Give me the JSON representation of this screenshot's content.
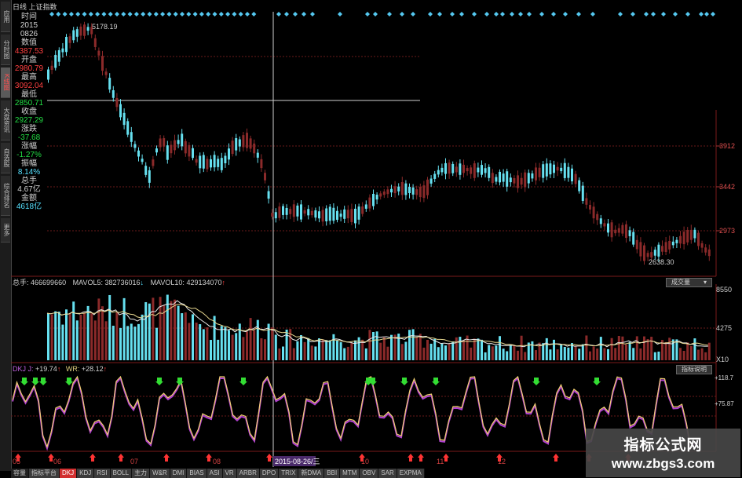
{
  "header": {
    "title": "日线 上证指数"
  },
  "left_nav": [
    {
      "label": "应用"
    },
    {
      "label": "分时图"
    },
    {
      "label": "K线图",
      "active": true
    },
    {
      "label": "大盘资讯"
    },
    {
      "label": "自选股"
    },
    {
      "label": "综合排名"
    },
    {
      "label": "更多"
    }
  ],
  "info_panel": [
    {
      "label": "时间",
      "value": "2015",
      "value2": "0826",
      "color": "white"
    },
    {
      "label": "数值",
      "value": "4387.53",
      "color": "red"
    },
    {
      "label": "开盘",
      "value": "2980.79",
      "color": "red"
    },
    {
      "label": "最高",
      "value": "3092.04",
      "color": "red"
    },
    {
      "label": "最低",
      "value": "2850.71",
      "color": "green"
    },
    {
      "label": "收盘",
      "value": "2927.29",
      "color": "green"
    },
    {
      "label": "涨跌",
      "value": "-37.68",
      "color": "green"
    },
    {
      "label": "涨幅",
      "value": "-1.27%",
      "color": "green"
    },
    {
      "label": "振幅",
      "value": "8.14%",
      "color": "cyan"
    },
    {
      "label": "总手",
      "value": "4.67亿",
      "color": "white"
    },
    {
      "label": "金额",
      "value": "4618亿",
      "color": "cyan"
    }
  ],
  "price_panel": {
    "high_label": "5178.19",
    "low_label": "2638.30",
    "axis_ticks": [
      "3912",
      "3442",
      "2973"
    ]
  },
  "volume_panel": {
    "summary": {
      "total_label": "总手:",
      "total": "466699660",
      "mavol5_label": "MAVOL5:",
      "mavol5": "382736016",
      "mavol10_label": "MAVOL10:",
      "mavol10": "429134070"
    },
    "selector": "成交量",
    "axis_ticks": [
      "8550",
      "4275",
      "X10"
    ]
  },
  "indicator_panel": {
    "name": "DKJ J:",
    "j_value": "+19.74",
    "wr_label": "WR:",
    "wr_value": "+28.12",
    "help_button": "指标说明",
    "axis_ticks": [
      "+118.7",
      "+75.87"
    ]
  },
  "x_axis": {
    "labels": [
      "05",
      "06",
      "07",
      "08",
      "10",
      "11",
      "12"
    ],
    "cursor_date": "2015-08-26/三"
  },
  "bottom_tabs": [
    {
      "label": "容量",
      "style": "dark"
    },
    {
      "label": "指标平台",
      "style": "normal"
    },
    {
      "label": "DKJ",
      "style": "active"
    },
    {
      "label": "KDJ"
    },
    {
      "label": "RSI"
    },
    {
      "label": "BOLL"
    },
    {
      "label": "主力"
    },
    {
      "label": "W&R"
    },
    {
      "label": "DMI"
    },
    {
      "label": "BIAS"
    },
    {
      "label": "ASI"
    },
    {
      "label": "VR"
    },
    {
      "label": "ARBR"
    },
    {
      "label": "DPO"
    },
    {
      "label": "TRIX"
    },
    {
      "label": "新DMA"
    },
    {
      "label": "BBI"
    },
    {
      "label": "MTM"
    },
    {
      "label": "OBV"
    },
    {
      "label": "SAR"
    },
    {
      "label": "EXPMA"
    }
  ],
  "watermark": {
    "line1": "指标公式网",
    "line2": "www.zbgs3.com"
  },
  "colors": {
    "up": "#8b2a2a",
    "down": "#66e0f0",
    "grid": "#7a1a1a",
    "ma_white": "#e8e8e8",
    "ma_yellow": "#e8d890",
    "indicator_purple": "#b040d0",
    "indicator_yellow": "#f0d070",
    "arrow_green": "#33dd33",
    "arrow_red": "#ff3333"
  }
}
